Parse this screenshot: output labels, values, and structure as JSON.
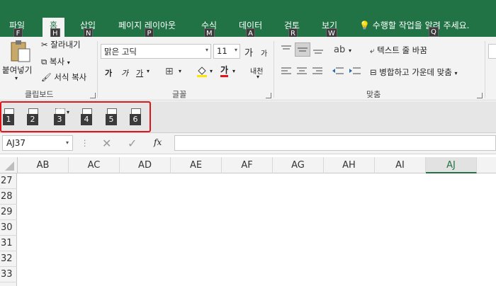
{
  "tabs": [
    {
      "label": "파일",
      "key": "F"
    },
    {
      "label": "홈",
      "key": "H"
    },
    {
      "label": "삽입",
      "key": "N"
    },
    {
      "label": "페이지 레이아웃",
      "key": "P"
    },
    {
      "label": "수식",
      "key": "M"
    },
    {
      "label": "데이터",
      "key": "A"
    },
    {
      "label": "검토",
      "key": "R"
    },
    {
      "label": "보기",
      "key": "W"
    }
  ],
  "tell_me": {
    "text": "수행할 작업을 알려 주세요.",
    "key": "Q"
  },
  "clipboard": {
    "paste": "붙여넣기",
    "cut": "잘라내기",
    "copy": "복사",
    "format_painter": "서식 복사",
    "group_label": "클립보드"
  },
  "font": {
    "name": "맑은 고딕",
    "size": "11",
    "grow": "가",
    "shrink": "가",
    "bold": "가",
    "italic": "가",
    "underline": "가",
    "font_color": "가",
    "phonetic": "내천",
    "group_label": "글꼴"
  },
  "alignment": {
    "wrap_text": "텍스트 줄 바꿈",
    "merge_center": "병합하고 가운데 맞춤",
    "group_label": "맞춤"
  },
  "qat_shortcuts": [
    "1",
    "2",
    "3",
    "4",
    "5",
    "6"
  ],
  "name_box": "AJ37",
  "fx": "fx",
  "columns": [
    "AB",
    "AC",
    "AD",
    "AE",
    "AF",
    "AG",
    "AH",
    "AI",
    "AJ"
  ],
  "rows": [
    "27",
    "28",
    "29",
    "30",
    "31",
    "32",
    "33"
  ],
  "colors": {
    "brand": "#217346",
    "highlight": "#e0151b"
  }
}
